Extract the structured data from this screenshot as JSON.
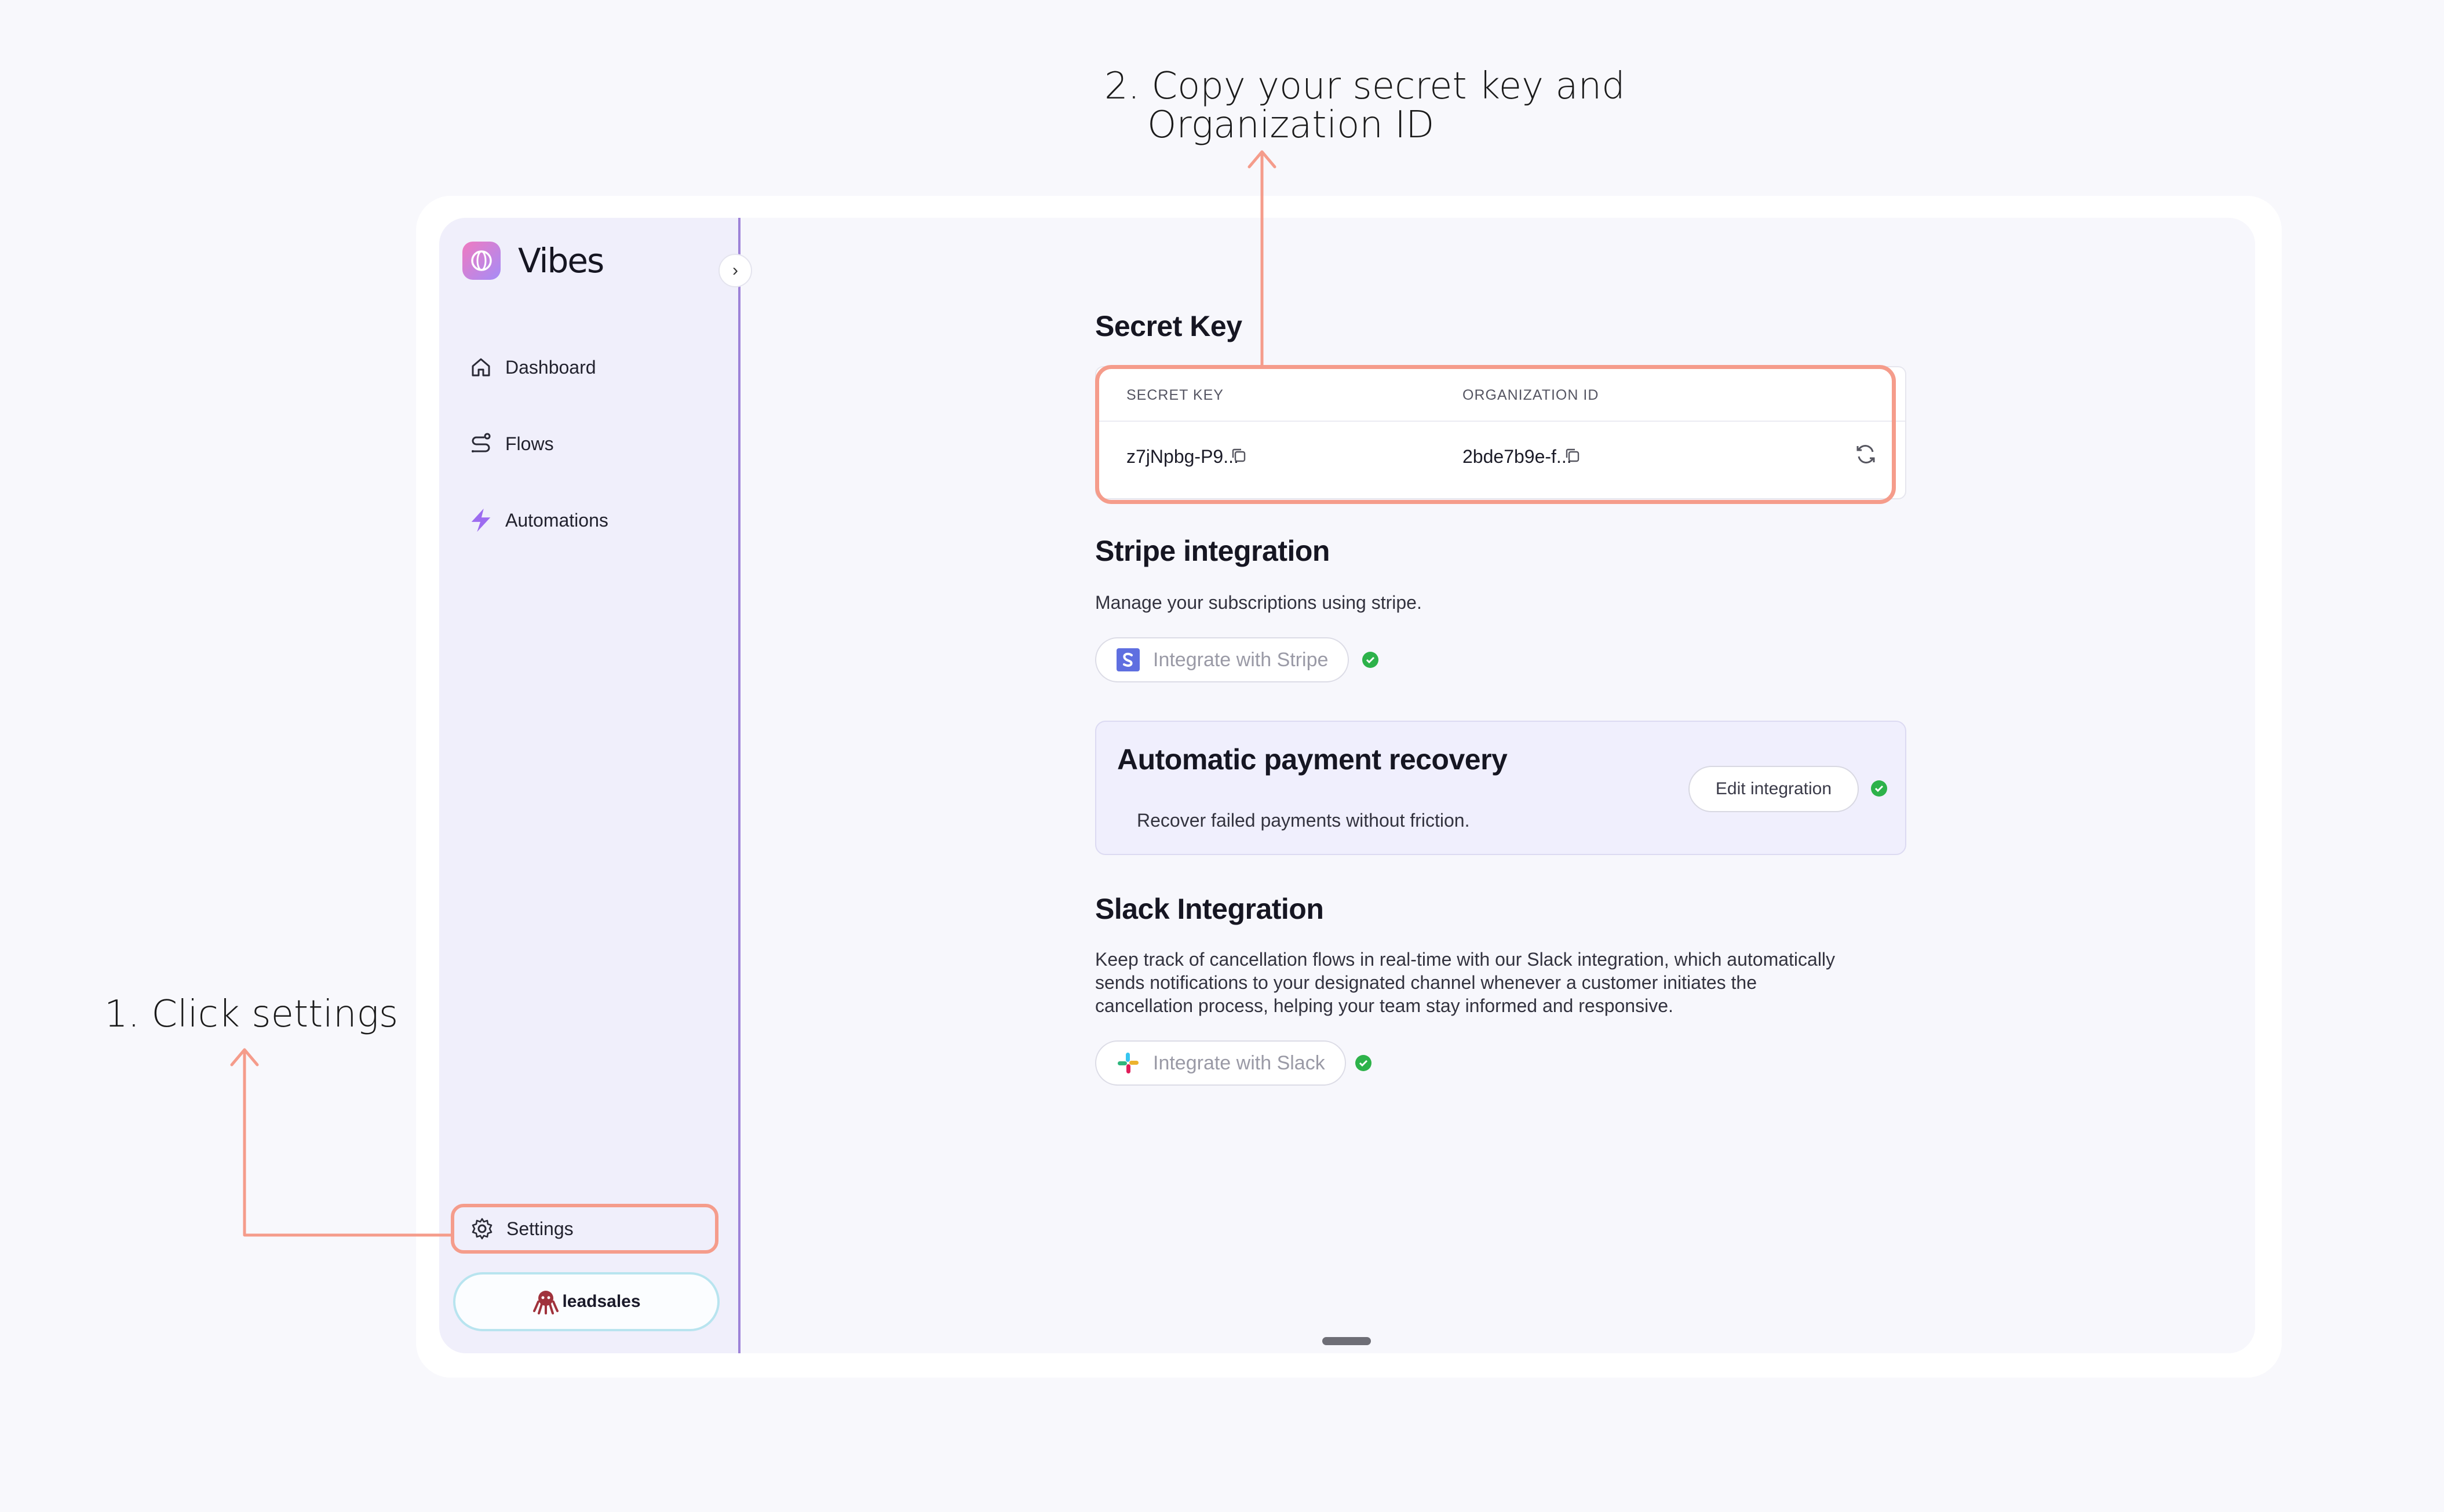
{
  "annotations": {
    "step1_text": "1. Click settings",
    "step2_line1": "2. Copy your secret key and",
    "step2_line2": "Organization ID",
    "highlight_color": "#f59c8b"
  },
  "app": {
    "brand_name": "Vibes",
    "sidebar": {
      "collapse_icon": "chevron-right-icon",
      "items": [
        {
          "label": "Dashboard",
          "icon": "home-icon"
        },
        {
          "label": "Flows",
          "icon": "flows-icon"
        },
        {
          "label": "Automations",
          "icon": "bolt-icon"
        }
      ],
      "settings_label": "Settings",
      "settings_icon": "gear-icon",
      "org_name": "leadsales",
      "org_icon": "octopus-icon"
    },
    "secret_key_section": {
      "title": "Secret Key",
      "secret_key_label": "SECRET KEY",
      "secret_key_value": "z7jNpbg-P9...",
      "org_id_label": "ORGANIZATION ID",
      "org_id_value": "2bde7b9e-f...",
      "copy_icon": "copy-icon",
      "refresh_icon": "refresh-icon"
    },
    "stripe_section": {
      "title": "Stripe integration",
      "description": "Manage your subscriptions using stripe.",
      "button_label": "Integrate with Stripe",
      "status": "connected",
      "status_color": "#2db24a"
    },
    "recovery_section": {
      "title": "Automatic payment recovery",
      "description": "Recover failed payments without friction.",
      "button_label": "Edit integration",
      "status": "connected"
    },
    "slack_section": {
      "title": "Slack Integration",
      "description_line1": "Keep track of cancellation flows in real-time with our Slack integration, which automatically",
      "description_line2": "sends notifications to your designated channel whenever a customer initiates the",
      "description_line3": "cancellation process, helping your team stay informed and responsive.",
      "button_label": "Integrate with Slack",
      "status": "connected"
    }
  }
}
